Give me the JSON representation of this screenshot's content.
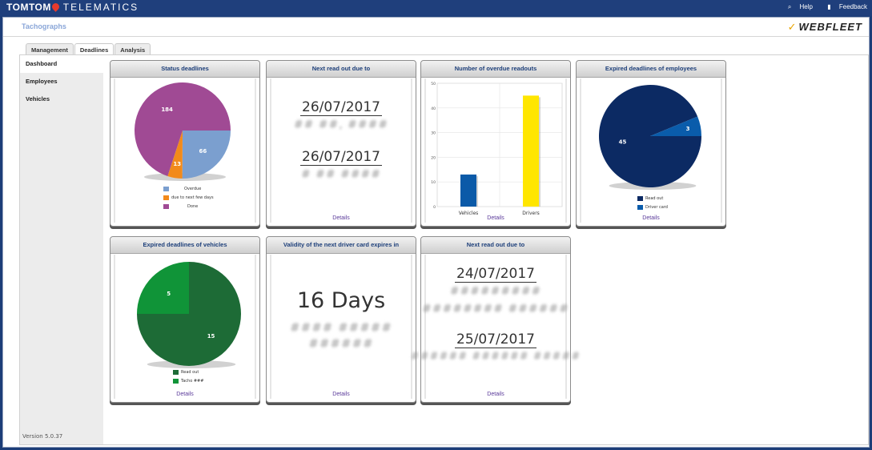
{
  "topbar": {
    "brand_strong": "TOMTOM",
    "brand_rest": "TELEMATICS",
    "help": "Help",
    "feedback": "Feedback"
  },
  "header": {
    "title": "Tachographs",
    "logo": "WEBFLEET"
  },
  "tabs": [
    {
      "label": "Management"
    },
    {
      "label": "Deadlines"
    },
    {
      "label": "Analysis"
    }
  ],
  "sidebar": {
    "items": [
      {
        "label": "Dashboard"
      },
      {
        "label": "Employees"
      },
      {
        "label": "Vehicles"
      }
    ],
    "version": "Version 5.0.37"
  },
  "cards": {
    "status_deadlines": {
      "title": "Status deadlines",
      "legend": [
        "Overdue",
        "due to next few days",
        "Done"
      ],
      "colors": [
        "#7b9fcf",
        "#f28a1b",
        "#a04a94"
      ]
    },
    "next_readout": {
      "title": "Next read out due to",
      "date1": "26/07/2017",
      "blur1": "## ##, ####",
      "date2": "26/07/2017",
      "blur2": "# ## ####",
      "details": "Details"
    },
    "overdue_readouts": {
      "title": "Number of overdue readouts",
      "details": "Details"
    },
    "expired_employees": {
      "title": "Expired deadlines of employees",
      "legend": [
        "Read out",
        "Driver card"
      ],
      "colors": [
        "#0c2a63",
        "#0a5cab"
      ],
      "details": "Details"
    },
    "expired_vehicles": {
      "title": "Expired deadlines of vehicles",
      "legend": [
        "Read out",
        "Tacho ###"
      ],
      "colors": [
        "#1d6b36",
        "#109438"
      ],
      "details": "Details"
    },
    "driver_card_validity": {
      "title": "Validity of the next driver card expires in",
      "value": "16 Days",
      "blur1": "#### #####",
      "blur2": "######",
      "details": "Details"
    },
    "next_readout_2": {
      "title": "Next read out due to",
      "date1": "24/07/2017",
      "blur1": "#########",
      "blur2": "######## ######",
      "date2": "25/07/2017",
      "blur3": "###### ###### #####",
      "details": "Details"
    }
  },
  "chart_data": [
    {
      "type": "pie",
      "title": "Status deadlines",
      "labels": [
        "Overdue",
        "due to next few days",
        "Done"
      ],
      "values": [
        66,
        13,
        184
      ]
    },
    {
      "type": "bar",
      "title": "Number of overdue readouts",
      "categories": [
        "Vehicles",
        "Drivers"
      ],
      "values": [
        13,
        45
      ],
      "colors": [
        "#0b5aa8",
        "#ffe600"
      ],
      "ylim": [
        0,
        50
      ],
      "yticks": [
        0,
        10,
        20,
        30,
        40,
        50
      ]
    },
    {
      "type": "pie",
      "title": "Expired deadlines of employees",
      "labels": [
        "Read out",
        "Driver card"
      ],
      "values": [
        45,
        3
      ]
    },
    {
      "type": "pie",
      "title": "Expired deadlines of vehicles",
      "labels": [
        "Read out",
        "Tacho ###"
      ],
      "values": [
        15,
        5
      ]
    }
  ]
}
